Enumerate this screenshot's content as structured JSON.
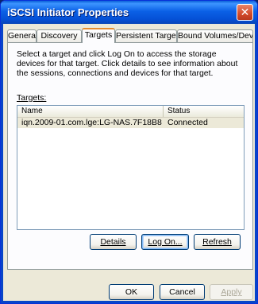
{
  "window": {
    "title": "iSCSI Initiator Properties",
    "close_glyph": "✕"
  },
  "tabs": [
    {
      "label": "General",
      "active": false
    },
    {
      "label": "Discovery",
      "active": false
    },
    {
      "label": "Targets",
      "active": true
    },
    {
      "label": "Persistent Targets",
      "active": false
    },
    {
      "label": "Bound Volumes/Devices",
      "active": false
    }
  ],
  "panel": {
    "description": "Select a target and click Log On to access the storage devices for that target. Click details to see information about the sessions, connections and devices for that target.",
    "targets_label": "Targets:",
    "columns": {
      "name": "Name",
      "status": "Status"
    },
    "rows": [
      {
        "name": "iqn.2009-01.com.lge:LG-NAS.7F18B8",
        "status": "Connected"
      }
    ],
    "buttons": {
      "details": "Details",
      "log_on": "Log On...",
      "refresh": "Refresh"
    }
  },
  "dialog_buttons": {
    "ok": "OK",
    "cancel": "Cancel",
    "apply": "Apply"
  },
  "colors": {
    "titlebar": "#0550d6",
    "body": "#ece9d8",
    "selected_row": "#ece9d8"
  }
}
